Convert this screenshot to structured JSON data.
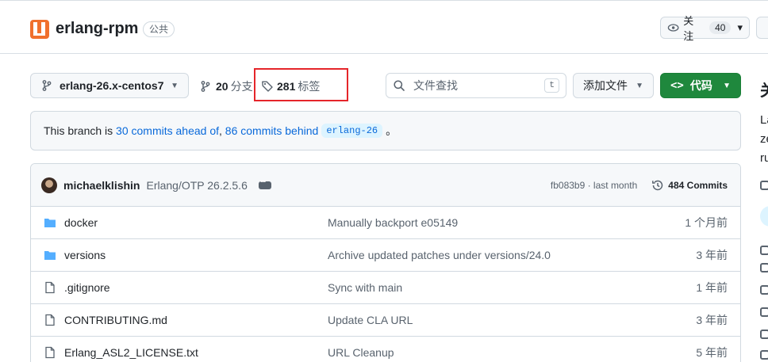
{
  "repo": {
    "name": "erlang-rpm",
    "visibility": "公共",
    "brand_color": "#f0702d"
  },
  "watch": {
    "label": "关注",
    "count": "40"
  },
  "toolbar": {
    "branch": "erlang-26.x-centos7",
    "branch_count": "20",
    "branch_label": "分支",
    "tag_count": "281",
    "tag_label": "标签",
    "search_placeholder": "文件查找",
    "search_shortcut": "t",
    "add_file": "添加文件",
    "code": "代码"
  },
  "banner": {
    "prefix": "This branch is",
    "ahead": "30 commits ahead of",
    "sep": ",",
    "behind": "86 commits behind",
    "base_branch": "erlang-26",
    "suffix": "。"
  },
  "latest_commit": {
    "author": "michaelklishin",
    "message": "Erlang/OTP 26.2.5.6",
    "sha_time": "fb083b9 · last month",
    "commits": "484 Commits"
  },
  "files": [
    {
      "name": "docker",
      "type": "folder",
      "message": "Manually backport e05149",
      "date": "1 个月前"
    },
    {
      "name": "versions",
      "type": "folder",
      "message": "Archive updated patches under versions/24.0",
      "date": "3 年前"
    },
    {
      "name": ".gitignore",
      "type": "file",
      "message": "Sync with main",
      "date": "1 年前"
    },
    {
      "name": "CONTRIBUTING.md",
      "type": "file",
      "message": "Update CLA URL",
      "date": "3 年前"
    },
    {
      "name": "Erlang_ASL2_LICENSE.txt",
      "type": "file",
      "message": "URL Cleanup",
      "date": "5 年前"
    }
  ],
  "sidebar": {
    "title_fragment": "关",
    "text_lines": [
      "La",
      "ze",
      "ru"
    ]
  },
  "colors": {
    "link": "#0969da",
    "primary": "#1f883d",
    "highlight": "#e5252a",
    "folder": "#54aeff"
  }
}
